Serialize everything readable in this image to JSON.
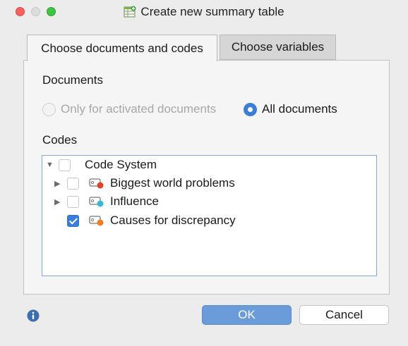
{
  "window": {
    "title": "Create new summary table",
    "title_icon": "summary-table-icon"
  },
  "tabs": [
    {
      "label": "Choose documents and codes",
      "active": true
    },
    {
      "label": "Choose variables",
      "active": false
    }
  ],
  "documents": {
    "heading": "Documents",
    "options": [
      {
        "label": "Only for activated documents",
        "selected": false,
        "enabled": false
      },
      {
        "label": "All documents",
        "selected": true,
        "enabled": true
      }
    ]
  },
  "codes": {
    "heading": "Codes",
    "tree": [
      {
        "label": "Code System",
        "expanded": true,
        "checked": false,
        "icon": null
      },
      {
        "label": "Biggest world problems",
        "expanded": false,
        "checked": false,
        "icon": "code-icon",
        "color": "#e0432a"
      },
      {
        "label": "Influence",
        "expanded": false,
        "checked": false,
        "icon": "code-icon",
        "color": "#38b6d6"
      },
      {
        "label": "Causes for discrepancy",
        "expanded": false,
        "checked": true,
        "icon": "code-icon",
        "color": "#f07d22"
      }
    ]
  },
  "footer": {
    "info_icon": "info-icon",
    "ok_label": "OK",
    "cancel_label": "Cancel"
  },
  "colors": {
    "accent": "#3b7ed8",
    "ok_button": "#6a9cd9"
  }
}
